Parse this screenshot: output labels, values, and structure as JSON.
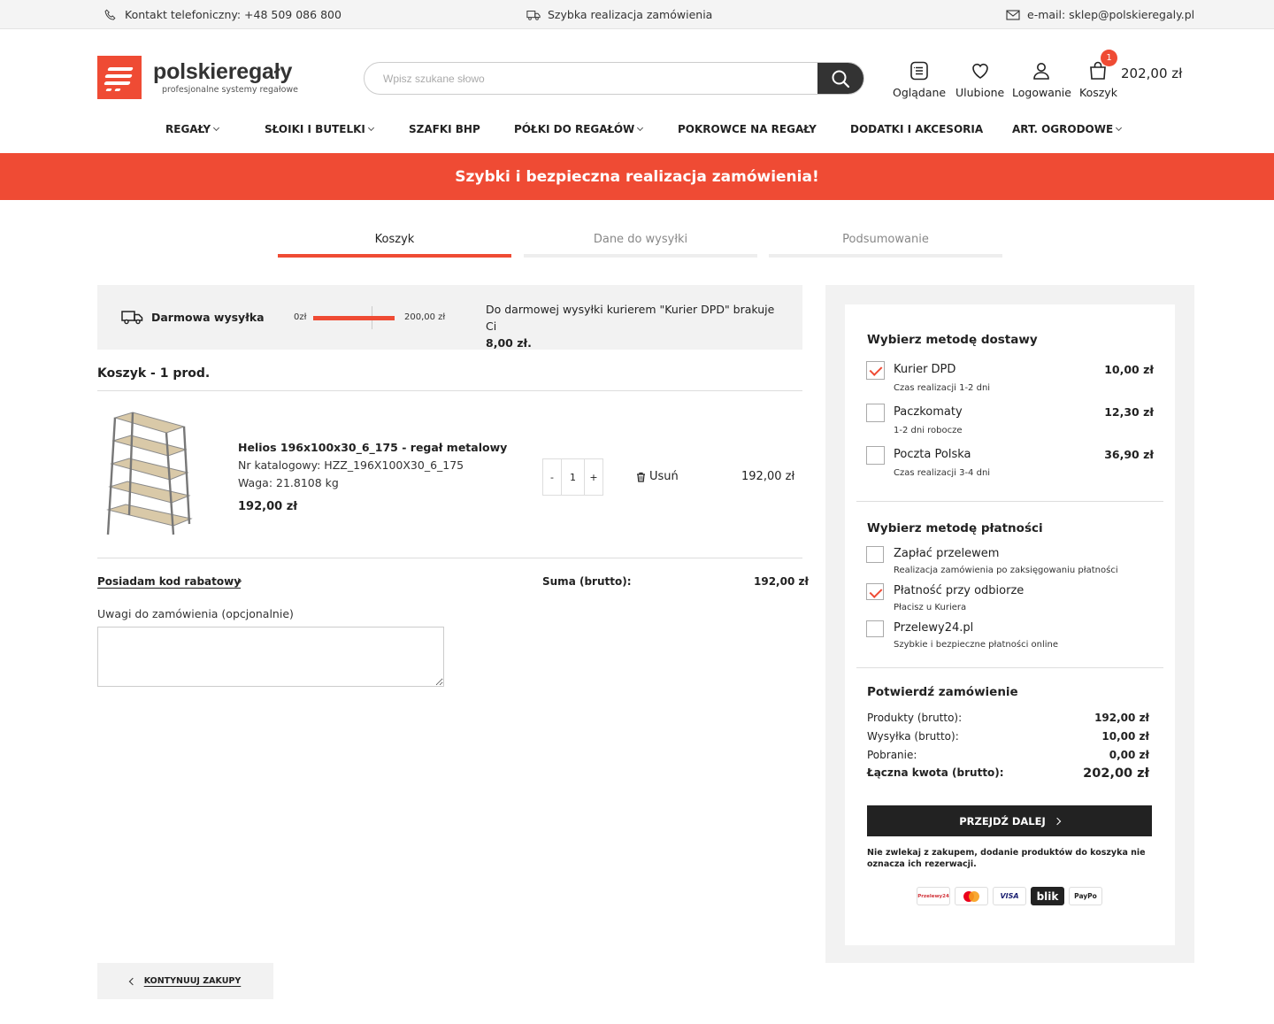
{
  "topbar": {
    "phone": "Kontakt telefoniczny: +48 509 086 800",
    "fast": "Szybka realizacja zamówienia",
    "email": "e-mail: sklep@polskieregaly.pl"
  },
  "logo": {
    "name": "polskieregały",
    "tagline": "profesjonalne systemy regałowe"
  },
  "search": {
    "placeholder": "Wpisz szukane słowo"
  },
  "header_icons": {
    "viewed": "Oglądane",
    "favorites": "Ulubione",
    "login": "Logowanie",
    "cart": "Koszyk",
    "cart_count": "1",
    "cart_total": "202,00 zł"
  },
  "nav": {
    "items": [
      {
        "label": "REGAŁY",
        "dropdown": true
      },
      {
        "label": "SŁOIKI I BUTELKI",
        "dropdown": true
      },
      {
        "label": "SZAFKI BHP",
        "dropdown": false
      },
      {
        "label": "PÓŁKI DO REGAŁÓW",
        "dropdown": true
      },
      {
        "label": "POKROWCE NA REGAŁY",
        "dropdown": false
      },
      {
        "label": "DODATKI I AKCESORIA",
        "dropdown": false
      },
      {
        "label": "ART. OGRODOWE",
        "dropdown": true
      }
    ]
  },
  "banner": {
    "text": "Szybki i bezpieczna realizacja zamówienia!"
  },
  "steps": {
    "items": [
      {
        "label": "Koszyk",
        "active": true
      },
      {
        "label": "Dane do wysyłki",
        "active": false
      },
      {
        "label": "Podsumowanie",
        "active": false
      }
    ]
  },
  "free_shipping": {
    "title": "Darmowa wysyłka",
    "min_label": "0zł",
    "max_label": "200,00 zł",
    "progress": 1.0,
    "message": "Do darmowej wysyłki kurierem \"Kurier DPD\" brakuje Ci",
    "missing": "8,00 zł."
  },
  "cart": {
    "title": "Koszyk - 1 prod.",
    "items": [
      {
        "name": "Helios 196x100x30_6_175 - regał metalowy",
        "catalog": "Nr katalogowy: HZZ_196X100X30_6_175",
        "weight": "Waga: 21.8108 kg",
        "price": "192,00 zł",
        "qty": "1",
        "minus": "-",
        "plus": "+",
        "remove": "Usuń",
        "total": "192,00 zł"
      }
    ],
    "coupon": "Posiadam kod rabatowy",
    "sum_label": "Suma (brutto):",
    "sum_value": "192,00 zł",
    "notes_label": "Uwagi do zamówienia (opcjonalnie)"
  },
  "continue": "KONTYNUUJ ZAKUPY",
  "delivery": {
    "title": "Wybierz metodę dostawy",
    "options": [
      {
        "name": "Kurier DPD",
        "sub": "Czas realizacji 1-2 dni",
        "price": "10,00 zł",
        "checked": true
      },
      {
        "name": "Paczkomaty",
        "sub": "1-2 dni robocze",
        "price": "12,30 zł",
        "checked": false
      },
      {
        "name": "Poczta Polska",
        "sub": "Czas realizacji 3-4 dni",
        "price": "36,90 zł",
        "checked": false
      }
    ]
  },
  "payment": {
    "title": "Wybierz metodę płatności",
    "options": [
      {
        "name": "Zapłać przelewem",
        "sub": "Realizacja zamówienia po zaksięgowaniu płatności",
        "checked": false
      },
      {
        "name": "Płatność przy odbiorze",
        "sub": "Płacisz u Kuriera",
        "checked": true
      },
      {
        "name": "Przelewy24.pl",
        "sub": "Szybkie i bezpieczne płatności online",
        "checked": false
      }
    ]
  },
  "summary": {
    "title": "Potwierdź zamówienie",
    "rows": [
      {
        "label": "Produkty (brutto):",
        "value": "192,00 zł"
      },
      {
        "label": "Wysyłka (brutto):",
        "value": "10,00 zł"
      },
      {
        "label": "Pobranie:",
        "value": "0,00 zł"
      },
      {
        "label": "Łączna kwota (brutto):",
        "value": "202,00 zł"
      }
    ],
    "button": "PRZEJDŹ DALEJ",
    "disclaimer": "Nie zwlekaj z zakupem, dodanie produktów do koszyka nie oznacza ich rezerwacji.",
    "payment_logos": [
      "Przelewy24",
      "Mastercard",
      "VISA",
      "blik",
      "PayPo"
    ]
  },
  "colors": {
    "accent": "#ef4b34",
    "dark": "#222222",
    "panel": "#f2f2f2"
  }
}
